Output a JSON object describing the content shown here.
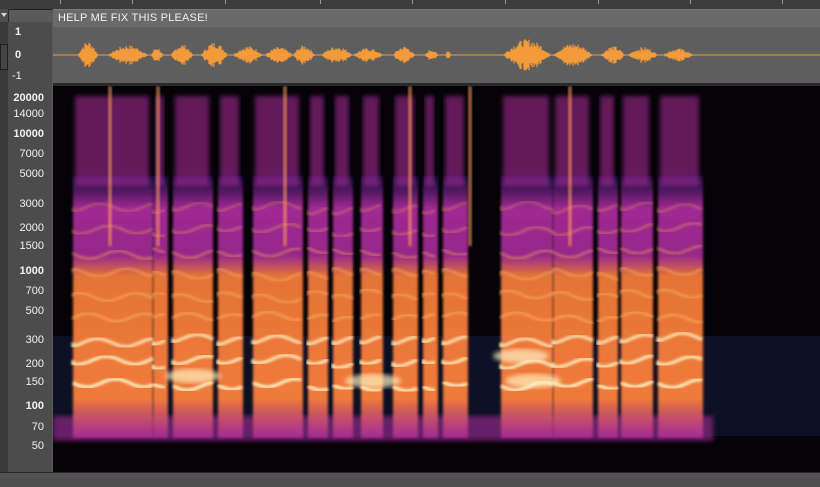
{
  "track": {
    "title": "HELP ME FIX THIS PLEASE!"
  },
  "amplitude_axis": {
    "top": "1",
    "mid": "0",
    "bottom": "-1"
  },
  "frequency_axis": {
    "ticks": [
      {
        "label": "20000",
        "bold": true
      },
      {
        "label": "14000",
        "bold": false
      },
      {
        "label": "10000",
        "bold": true
      },
      {
        "label": "7000",
        "bold": false
      },
      {
        "label": "5000",
        "bold": false
      },
      {
        "label": "3000",
        "bold": false
      },
      {
        "label": "2000",
        "bold": false
      },
      {
        "label": "1500",
        "bold": false
      },
      {
        "label": "1000",
        "bold": true
      },
      {
        "label": "700",
        "bold": false
      },
      {
        "label": "500",
        "bold": false
      },
      {
        "label": "300",
        "bold": false
      },
      {
        "label": "200",
        "bold": false
      },
      {
        "label": "150",
        "bold": false
      },
      {
        "label": "100",
        "bold": true
      },
      {
        "label": "70",
        "bold": false
      },
      {
        "label": "50",
        "bold": false
      }
    ]
  },
  "colors": {
    "waveform": "#f39a3a",
    "spectrum_hot": "#fff2c0",
    "spectrum_mid": "#f07a3a",
    "spectrum_low": "#b02da0",
    "spectrum_floor": "#2a1560",
    "background": "#050307"
  }
}
